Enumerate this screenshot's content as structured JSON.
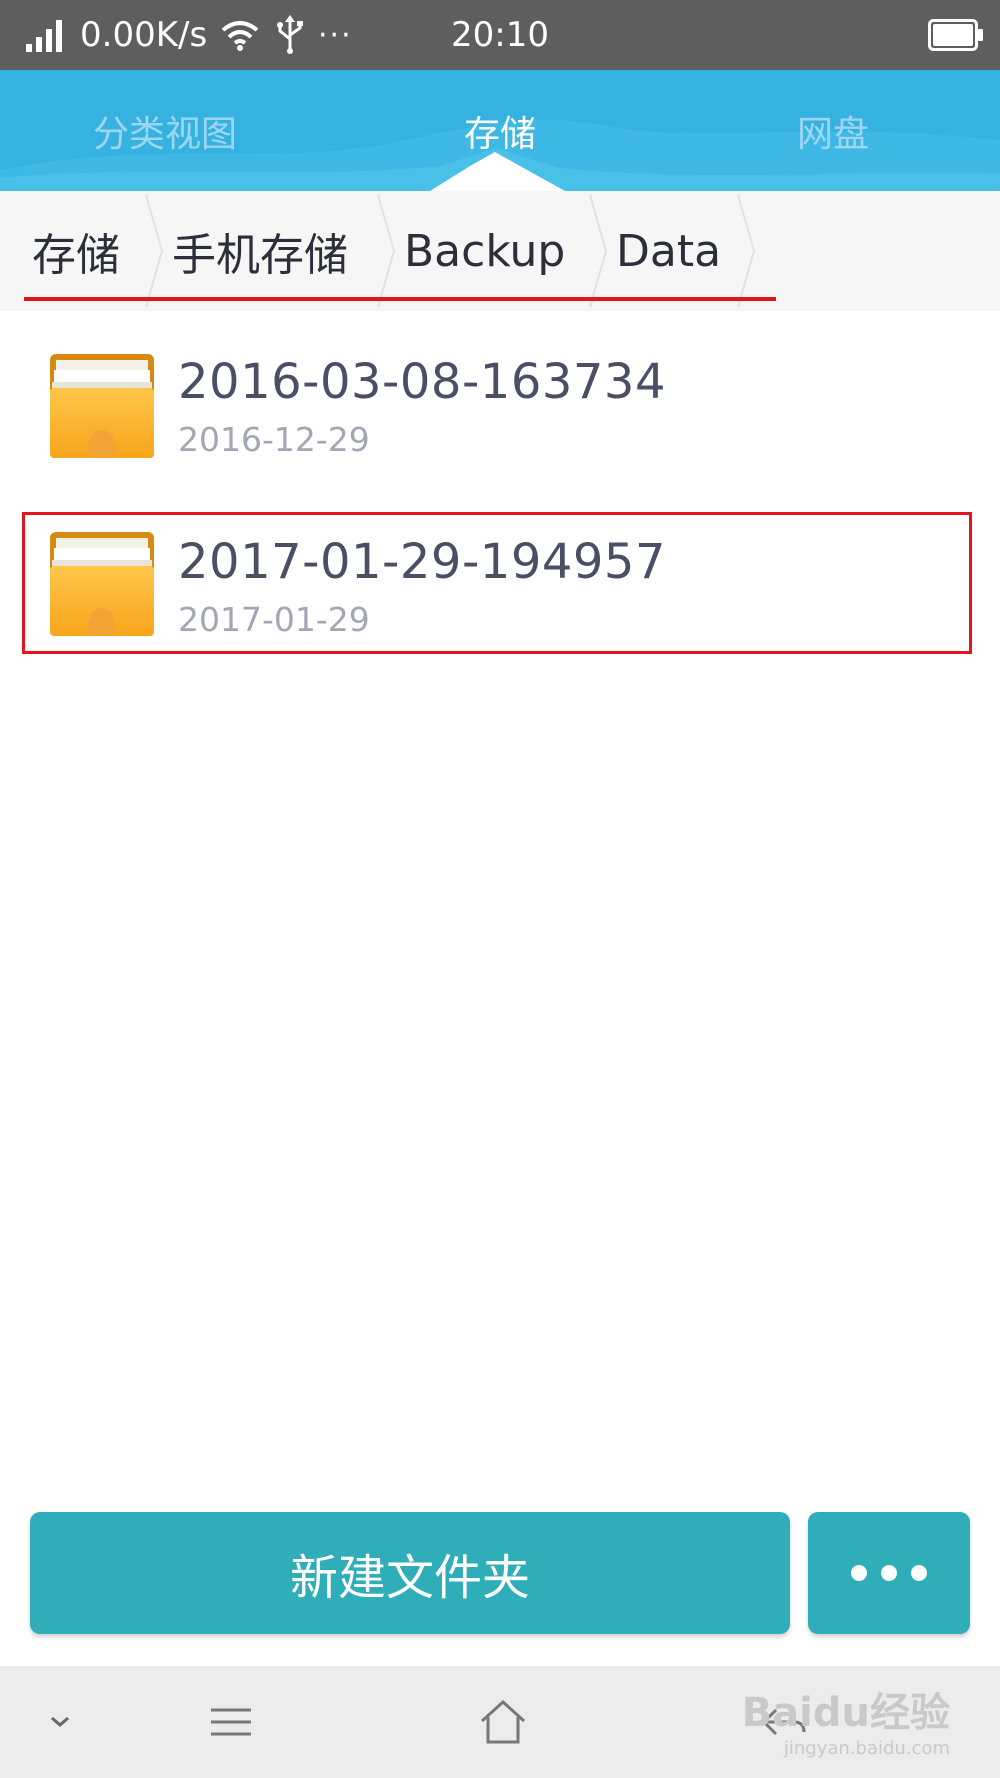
{
  "status_bar": {
    "network_speed": "0.00K/s",
    "more": "···",
    "time": "20:10",
    "icons": [
      "signal-icon",
      "wifi-icon",
      "usb-icon",
      "battery-icon"
    ]
  },
  "tabs": [
    {
      "label": "分类视图",
      "active": false
    },
    {
      "label": "存储",
      "active": true
    },
    {
      "label": "网盘",
      "active": false
    }
  ],
  "breadcrumb": [
    "存储",
    "手机存储",
    "Backup",
    "Data"
  ],
  "files": [
    {
      "name": "2016-03-08-163734",
      "date": "2016-12-29",
      "icon": "folder-icon"
    },
    {
      "name": "2017-01-29-194957",
      "date": "2017-01-29",
      "icon": "folder-icon"
    }
  ],
  "actions": {
    "new_folder_label": "新建文件夹",
    "more_icon": "more-dots-icon"
  },
  "nav": {
    "icons": [
      "chevron-down-icon",
      "menu-icon",
      "home-icon",
      "back-icon"
    ]
  },
  "watermark": {
    "main": "Baidu经验",
    "sub": "jingyan.baidu.com"
  },
  "colors": {
    "status_bar": "#5e5e5e",
    "header": "#35b2e0",
    "accent_button": "#2fadb9",
    "highlight": "#e4141f",
    "breadcrumb_underline": "#e4141f"
  }
}
